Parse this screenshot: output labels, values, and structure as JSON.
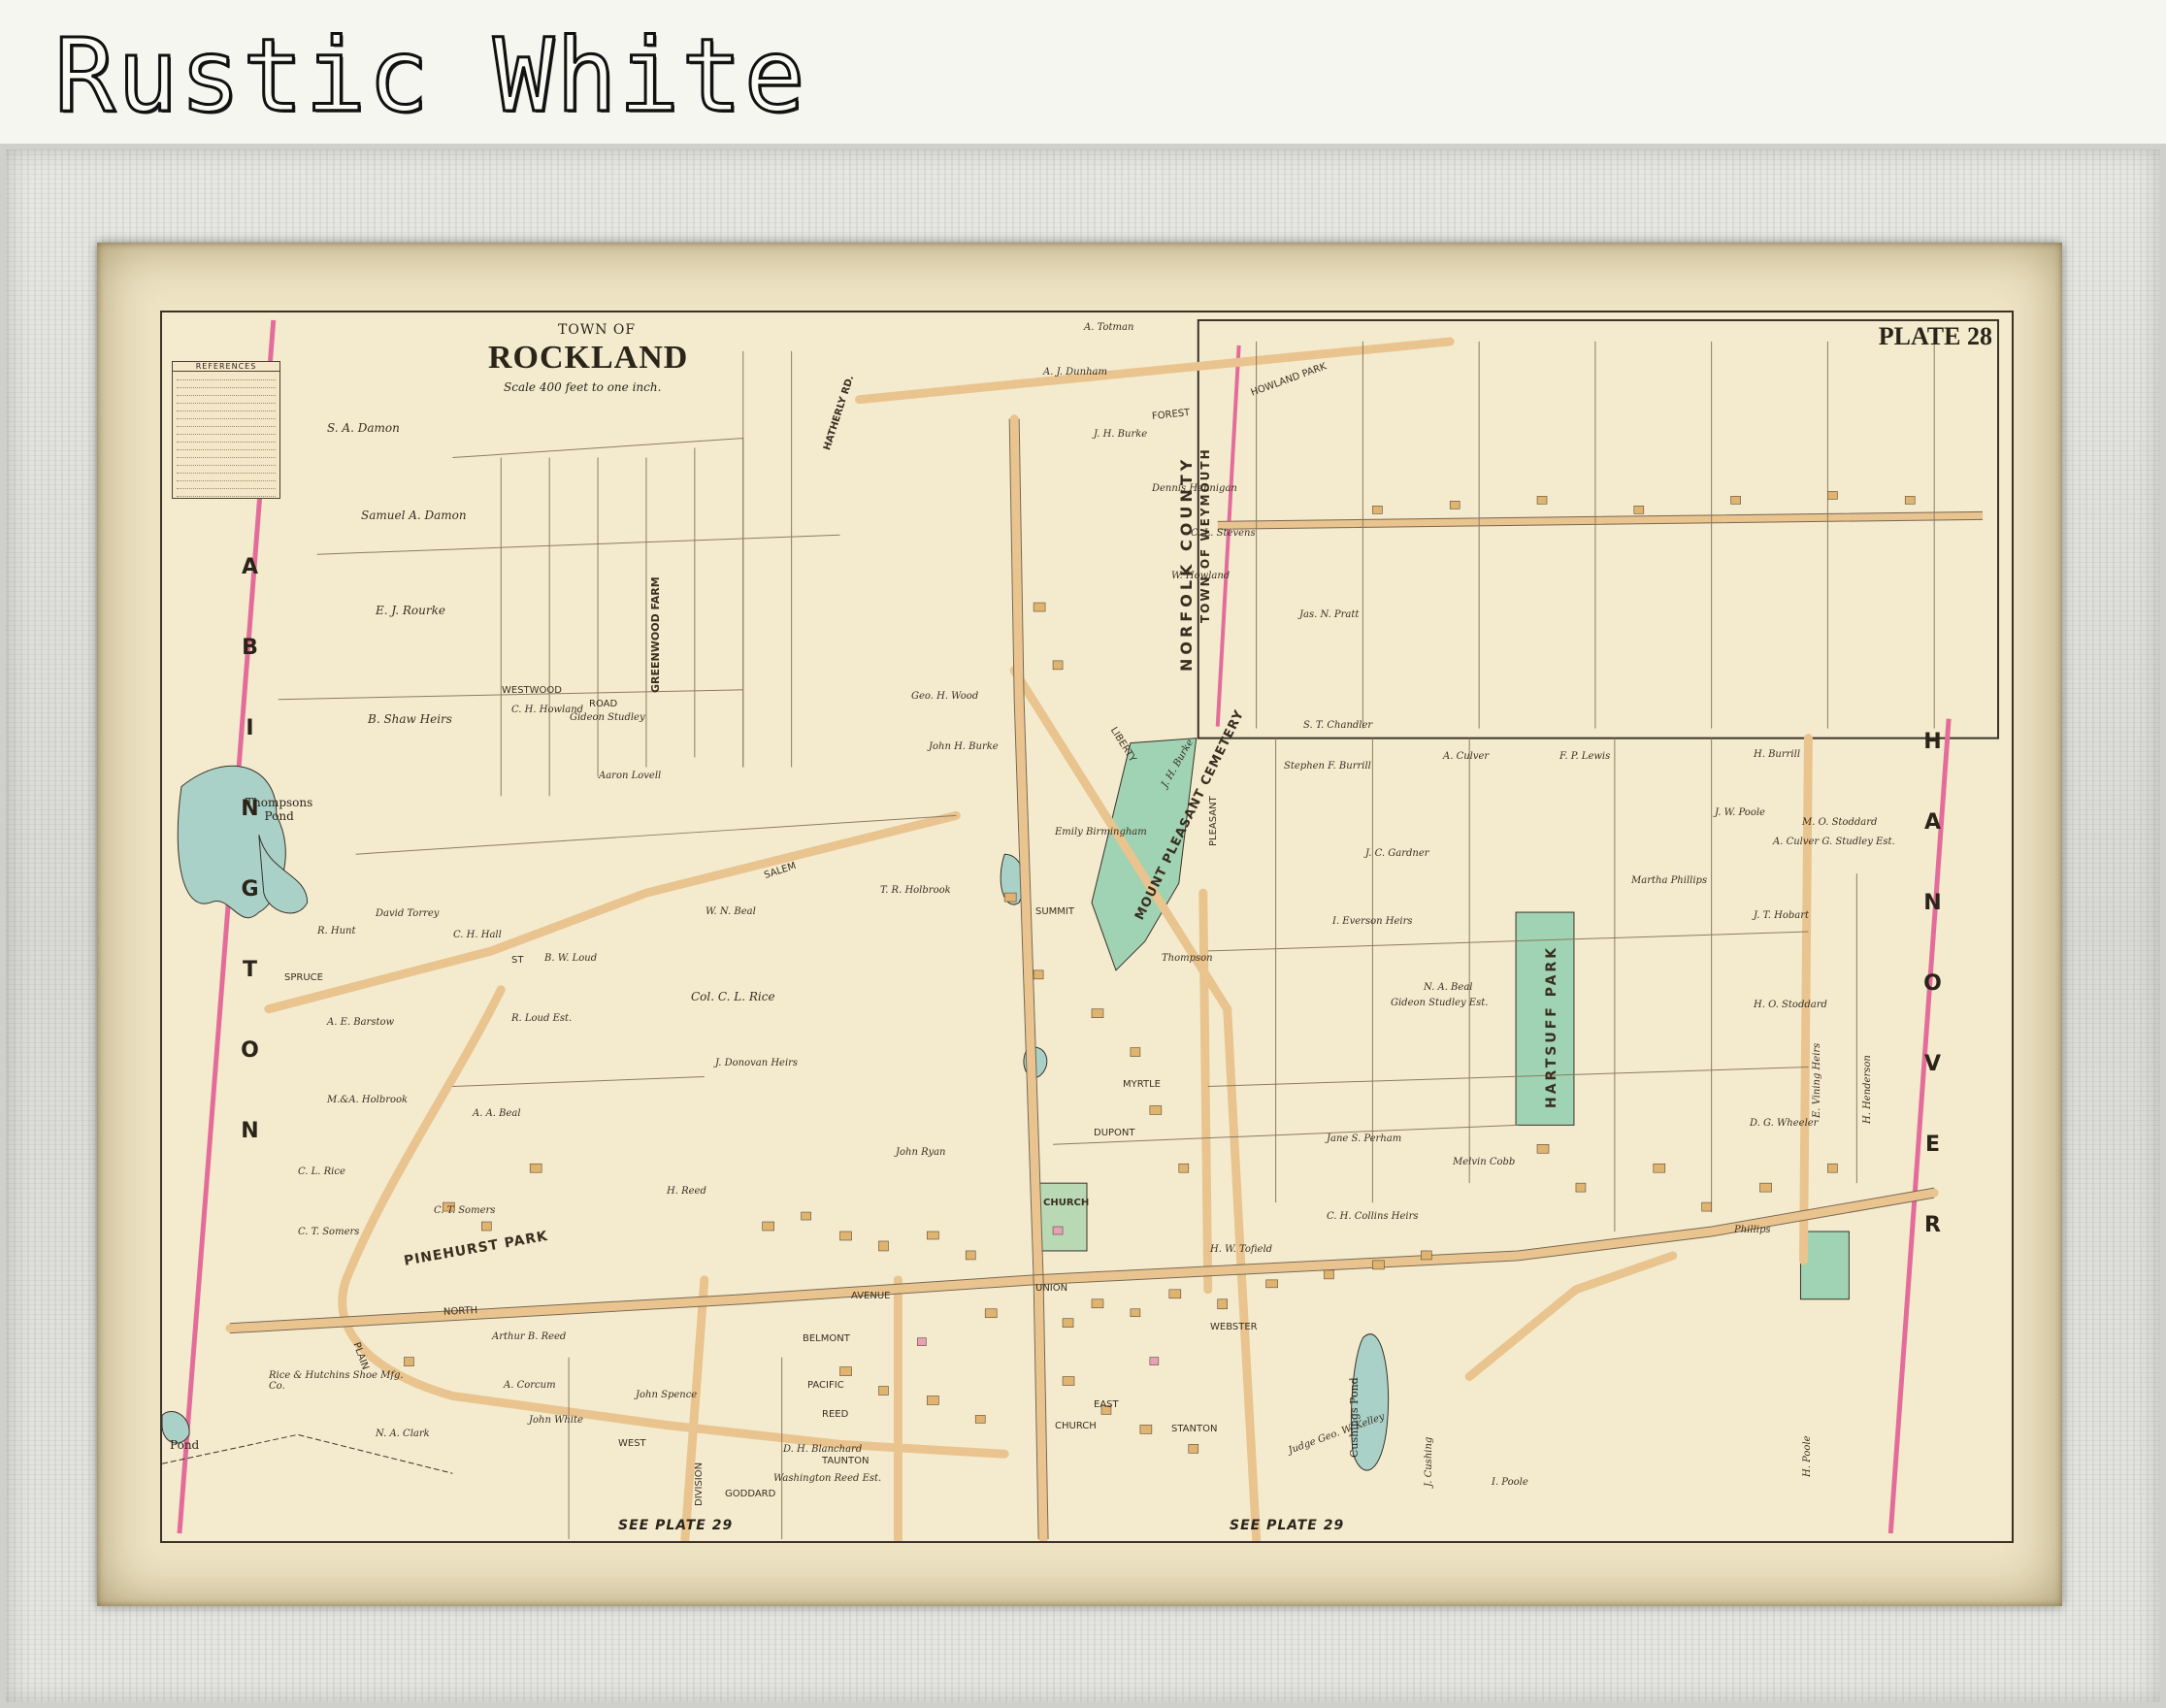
{
  "header": {
    "title": "Rustic White"
  },
  "map": {
    "plate": "PLATE 28",
    "town_of": "TOWN OF",
    "town_name": "ROCKLAND",
    "scale": "Scale 400 feet to one inch.",
    "legend_title": "REFERENCES",
    "see_plate_left": "SEE PLATE 29",
    "see_plate_right": "SEE PLATE 29",
    "west_border": "ABINGTON",
    "east_border": "HANOVER",
    "inset_county": "NORFOLK COUNTY",
    "inset_town": "TOWN OF WEYMOUTH",
    "water": {
      "thompsons_pond": "Thompsons\nPond",
      "pond": "Pond",
      "cushings_pond": "Cushings Pond"
    },
    "areas": {
      "cemetery": "MOUNT PLEASANT CEMETERY",
      "park": "HARTSUFF PARK",
      "pinehurst": "PINEHURST PARK",
      "greenwood": "GREENWOOD FARM",
      "church": "CHURCH"
    },
    "streets": [
      "SPRUCE",
      "ST",
      "SALEM",
      "FOREST",
      "ROAD",
      "WESTWOOD",
      "AVENUE",
      "BELMONT",
      "PACIFIC",
      "REED",
      "TAUNTON",
      "GODDARD",
      "DIVISION",
      "WEST",
      "NORTH",
      "PLAIN",
      "SUMMIT",
      "PLEASANT",
      "LIBERTY",
      "UNION",
      "EAST",
      "WEBSTER",
      "STANTON",
      "CHURCH",
      "HATHERLY RD.",
      "HOWLAND PARK",
      "DUPONT",
      "MYRTLE"
    ],
    "owners": [
      "S. A. Damon",
      "Samuel A. Damon",
      "E. J. Rourke",
      "B. Shaw Heirs",
      "Aaron Lovell",
      "R. Hunt",
      "David Torrey",
      "C. H. Hall",
      "A. E. Barstow",
      "M.&A. Holbrook",
      "A. A. Beal",
      "C. L. Rice",
      "C. T. Somers",
      "Rice & Hutchins Shoe Mfg. Co.",
      "N. A. Clark",
      "John White",
      "A. Corcum",
      "John Spence",
      "Arthur B. Reed",
      "Col. C. L. Rice",
      "J. Donovan Heirs",
      "W. N. Beal",
      "B. W. Loud",
      "R. Loud Est.",
      "John Ryan",
      "H. Reed",
      "D. H. Blanchard",
      "Washington Reed Est.",
      "Emily Birmingham",
      "T. R. Holbrook",
      "A. J. Dunham",
      "A. Totman",
      "Dennis Hennigan",
      "C. L. Stevens",
      "W. Howland",
      "J. H. Burke",
      "Jas. N. Pratt",
      "S. T. Chandler",
      "Stephen F. Burrill",
      "J. C. Gardner",
      "A. Culver",
      "F. P. Lewis",
      "Martha Phillips",
      "J. T. Hobart",
      "H. O. Stoddard",
      "M. O. Stoddard",
      "J. W. Poole",
      "H. Burrill",
      "I. Everson Heirs",
      "N. A. Beal",
      "Gideon Studley Est.",
      "Jane S. Perham",
      "C. H. Collins Heirs",
      "Melvin Cobb",
      "D. G. Wheeler",
      "E. Vining Heirs",
      "H. Henderson",
      "Judge Geo. W. Kelley",
      "I. Poole",
      "J. Cushing",
      "J. H. Burke",
      "Geo. H. Wood",
      "John H. Burke",
      "C. H. Howland",
      "Gideon Studley",
      "C. T. Somers",
      "H. W. Tofield",
      "H. Poole",
      "Thompson",
      "Phillips",
      "A. Culver G. Studley Est."
    ]
  },
  "colors": {
    "paper": "#f4ebcf",
    "border_pink": "#e36c9a",
    "water": "#a9d1c8",
    "park_green": "#9fd3b3",
    "road": "#e9c48e",
    "ink": "#2b2419"
  }
}
